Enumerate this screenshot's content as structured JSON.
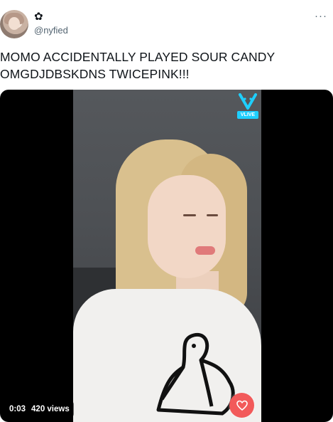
{
  "author": {
    "display_name": "✿",
    "handle": "@nyfied"
  },
  "tweet": {
    "text_line_1": "MOMO ACCIDENTALLY PLAYED SOUR CANDY",
    "text_line_2": "OMGDJDBSKDNS TWICEPINK!!!"
  },
  "media": {
    "timestamp": "0:03",
    "views": "420 views",
    "watermark_badge": "VLIVE"
  },
  "menu": {
    "more_glyph": "···"
  },
  "icons": {
    "more": "more-horizontal-icon",
    "vlive": "vlive-logo-icon",
    "heart": "finger-heart-icon"
  },
  "colors": {
    "text": "#0f1419",
    "secondary_text": "#536471",
    "media_bg": "#000000",
    "vlive": "#1ecfff",
    "heart_button": "#f25a5a"
  }
}
